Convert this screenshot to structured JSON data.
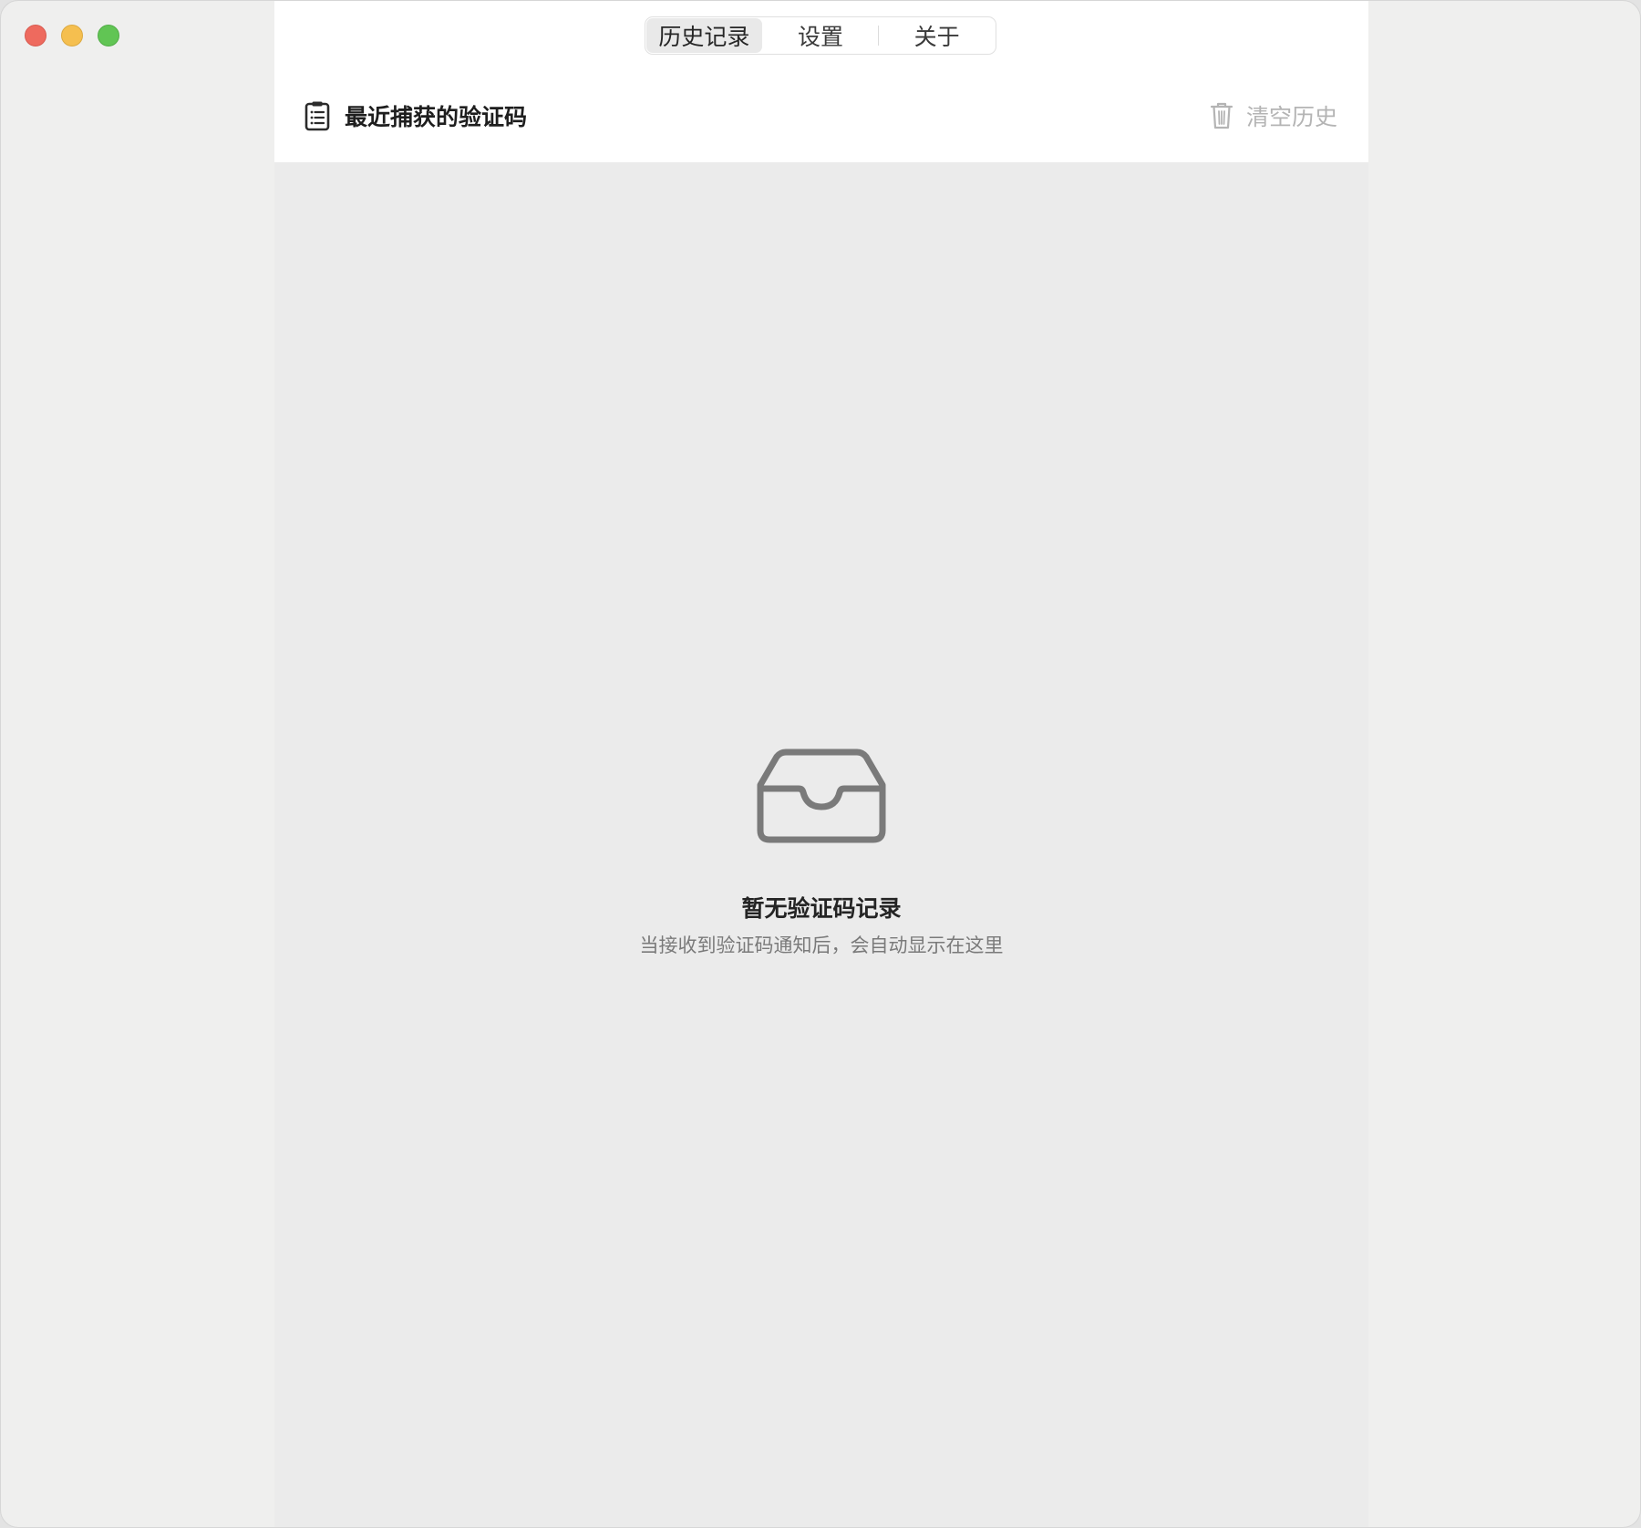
{
  "window": {
    "controls": [
      "close",
      "minimize",
      "zoom"
    ]
  },
  "tabs": [
    {
      "label": "历史记录",
      "active": true
    },
    {
      "label": "设置",
      "active": false
    },
    {
      "label": "关于",
      "active": false
    }
  ],
  "header": {
    "title": "最近捕获的验证码",
    "title_icon": "clipboard-list-icon",
    "clear_label": "清空历史",
    "clear_icon": "trash-icon"
  },
  "empty_state": {
    "icon": "inbox-tray-icon",
    "title": "暂无验证码记录",
    "subtitle": "当接收到验证码通知后，会自动显示在这里"
  },
  "colors": {
    "sidebar_bg": "#efefee",
    "header_bg": "#ffffff",
    "content_bg": "#ebebeb",
    "close": "#ee6a5e",
    "minimize": "#f5bf4f",
    "zoom": "#61c554",
    "muted_text": "#b4b4b4"
  }
}
